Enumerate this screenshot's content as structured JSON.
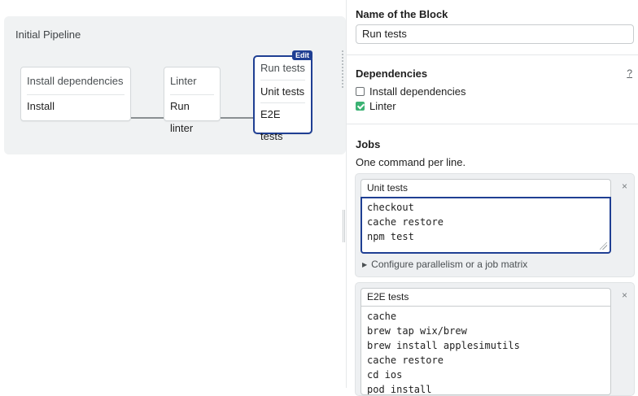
{
  "pipeline": {
    "title": "Initial Pipeline",
    "blocks": [
      {
        "name": "Install dependencies",
        "jobs": [
          "Install"
        ]
      },
      {
        "name": "Linter",
        "jobs": [
          "Run linter"
        ]
      },
      {
        "name": "Run tests",
        "jobs": [
          "Unit tests",
          "E2E tests"
        ],
        "badge": "Edit"
      }
    ]
  },
  "editor": {
    "name_label": "Name of the Block",
    "name_value": "Run tests",
    "dependencies_label": "Dependencies",
    "dependencies_help": "?",
    "dependencies": [
      {
        "label": "Install dependencies",
        "checked": false
      },
      {
        "label": "Linter",
        "checked": true
      }
    ],
    "jobs_label": "Jobs",
    "jobs_hint": "One command per line.",
    "jobs": [
      {
        "name": "Unit tests",
        "commands": [
          "checkout",
          "cache restore",
          "npm test"
        ],
        "parallelism_link": "Configure parallelism or a job matrix",
        "close": "×"
      },
      {
        "name": "E2E tests",
        "commands": [
          "cache",
          "brew tap wix/brew",
          "brew install applesimutils",
          "cache restore",
          "cd ios",
          "pod install"
        ],
        "close": "×"
      }
    ]
  },
  "colors": {
    "accent": "#1f3f93",
    "check_green": "#3bb273",
    "canvas_bg": "#f0f2f3"
  }
}
